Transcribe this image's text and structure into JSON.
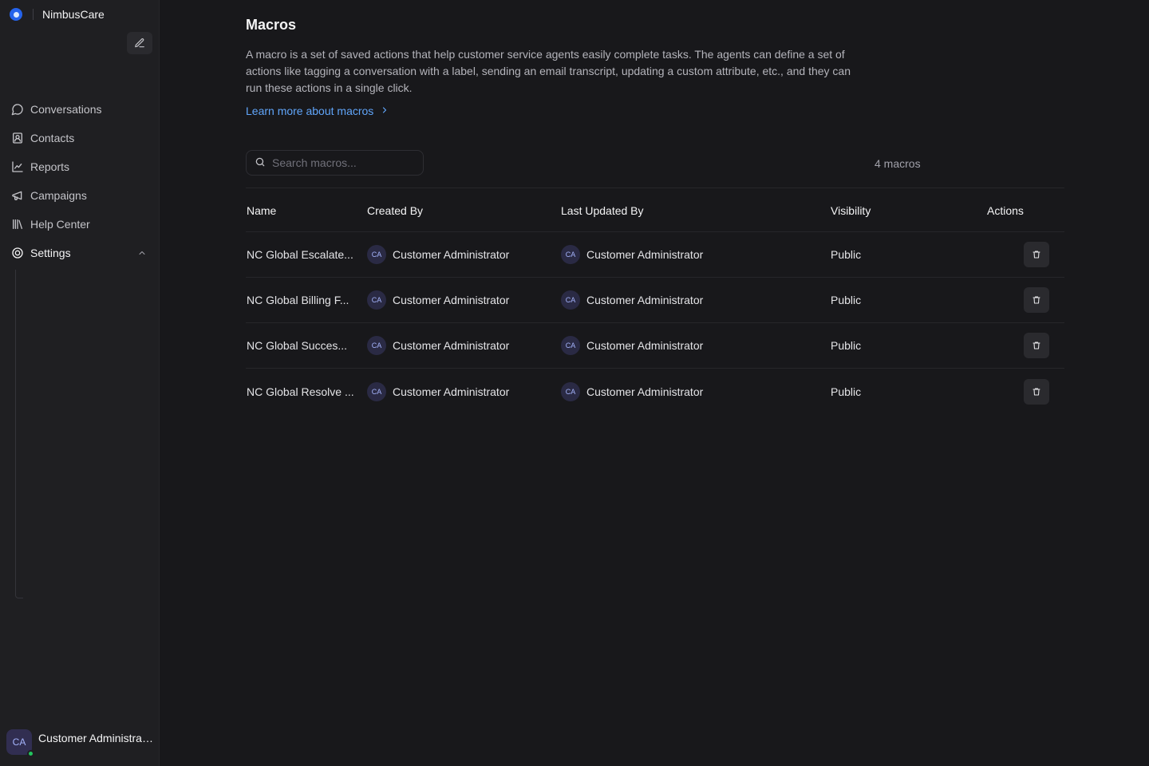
{
  "sidebar": {
    "brand_name": "NimbusCare",
    "items": [
      {
        "label": "Conversations",
        "icon": "chat-bubble-icon"
      },
      {
        "label": "Contacts",
        "icon": "contact-book-icon"
      },
      {
        "label": "Reports",
        "icon": "line-chart-icon"
      },
      {
        "label": "Campaigns",
        "icon": "megaphone-icon"
      },
      {
        "label": "Help Center",
        "icon": "library-icon"
      },
      {
        "label": "Settings",
        "icon": "settings-icon",
        "expanded": true
      }
    ],
    "user": {
      "initials": "CA",
      "name": "Customer Administrator",
      "status_color": "#22c55e"
    }
  },
  "page": {
    "title": "Macros",
    "description": "A macro is a set of saved actions that help customer service agents easily complete tasks. The agents can define a set of actions like tagging a conversation with a label, sending an email transcript, updating a custom attribute, etc., and they can run these actions in a single click.",
    "learn_more": "Learn more about macros",
    "search_placeholder": "Search macros...",
    "count_label": "4 macros"
  },
  "table": {
    "headers": {
      "name": "Name",
      "created_by": "Created By",
      "last_updated_by": "Last Updated By",
      "visibility": "Visibility",
      "actions": "Actions"
    },
    "rows": [
      {
        "name": "NC Global Escalate...",
        "created_initials": "CA",
        "created_by": "Customer Administrator",
        "updated_initials": "CA",
        "updated_by": "Customer Administrator",
        "visibility": "Public"
      },
      {
        "name": "NC Global Billing F...",
        "created_initials": "CA",
        "created_by": "Customer Administrator",
        "updated_initials": "CA",
        "updated_by": "Customer Administrator",
        "visibility": "Public"
      },
      {
        "name": "NC Global Succes...",
        "created_initials": "CA",
        "created_by": "Customer Administrator",
        "updated_initials": "CA",
        "updated_by": "Customer Administrator",
        "visibility": "Public"
      },
      {
        "name": "NC Global Resolve ...",
        "created_initials": "CA",
        "created_by": "Customer Administrator",
        "updated_initials": "CA",
        "updated_by": "Customer Administrator",
        "visibility": "Public"
      }
    ]
  },
  "colors": {
    "accent": "#60a5fa",
    "background": "#18181b",
    "sidebar": "#1f1f22"
  }
}
